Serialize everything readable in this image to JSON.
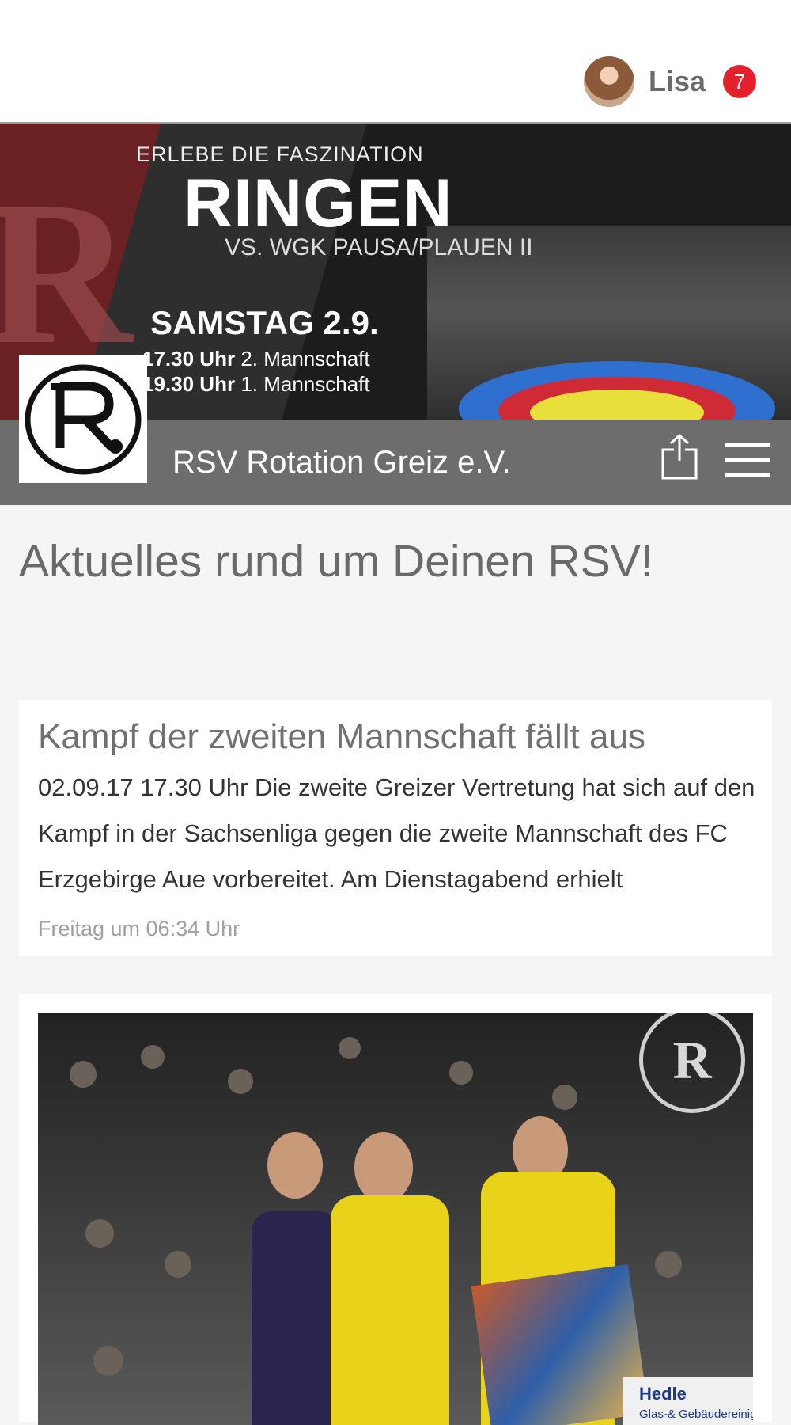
{
  "user": {
    "name": "Lisa",
    "notifications": "7"
  },
  "banner": {
    "line1": "ERLEBE DIE FASZINATION",
    "line2": "RINGEN",
    "line3": "VS. WGK PAUSA/PLAUEN II",
    "line4": "SAMSTAG 2.9.",
    "line5_time": "17.30 Uhr",
    "line5_team": "2. Mannschaft",
    "line6_time": "19.30 Uhr",
    "line6_team": "1. Mannschaft"
  },
  "club": {
    "name": "RSV Rotation Greiz e.V."
  },
  "page": {
    "heading": "Aktuelles rund um Deinen RSV!"
  },
  "posts": [
    {
      "title": "Kampf der zweiten Mannschaft fällt aus",
      "excerpt": "02.09.17 17.30 Uhr Die zweite Greizer Vertretung hat sich auf den Kampf in der Sachsenliga gegen die zweite Mannschaft des FC Erzgebirge Aue vorbereitet. Am Dienstagabend erhielt",
      "time": "Freitag um 06:34 Uhr"
    },
    {
      "photo_sponsor": "Hedle",
      "photo_sponsor_sub": "Glas-& Gebäudereinig"
    }
  ],
  "colors": {
    "badge": "#e3202b",
    "clubbar": "#6d6d6d"
  },
  "icons": {
    "share": "share-icon",
    "menu": "menu-icon"
  }
}
